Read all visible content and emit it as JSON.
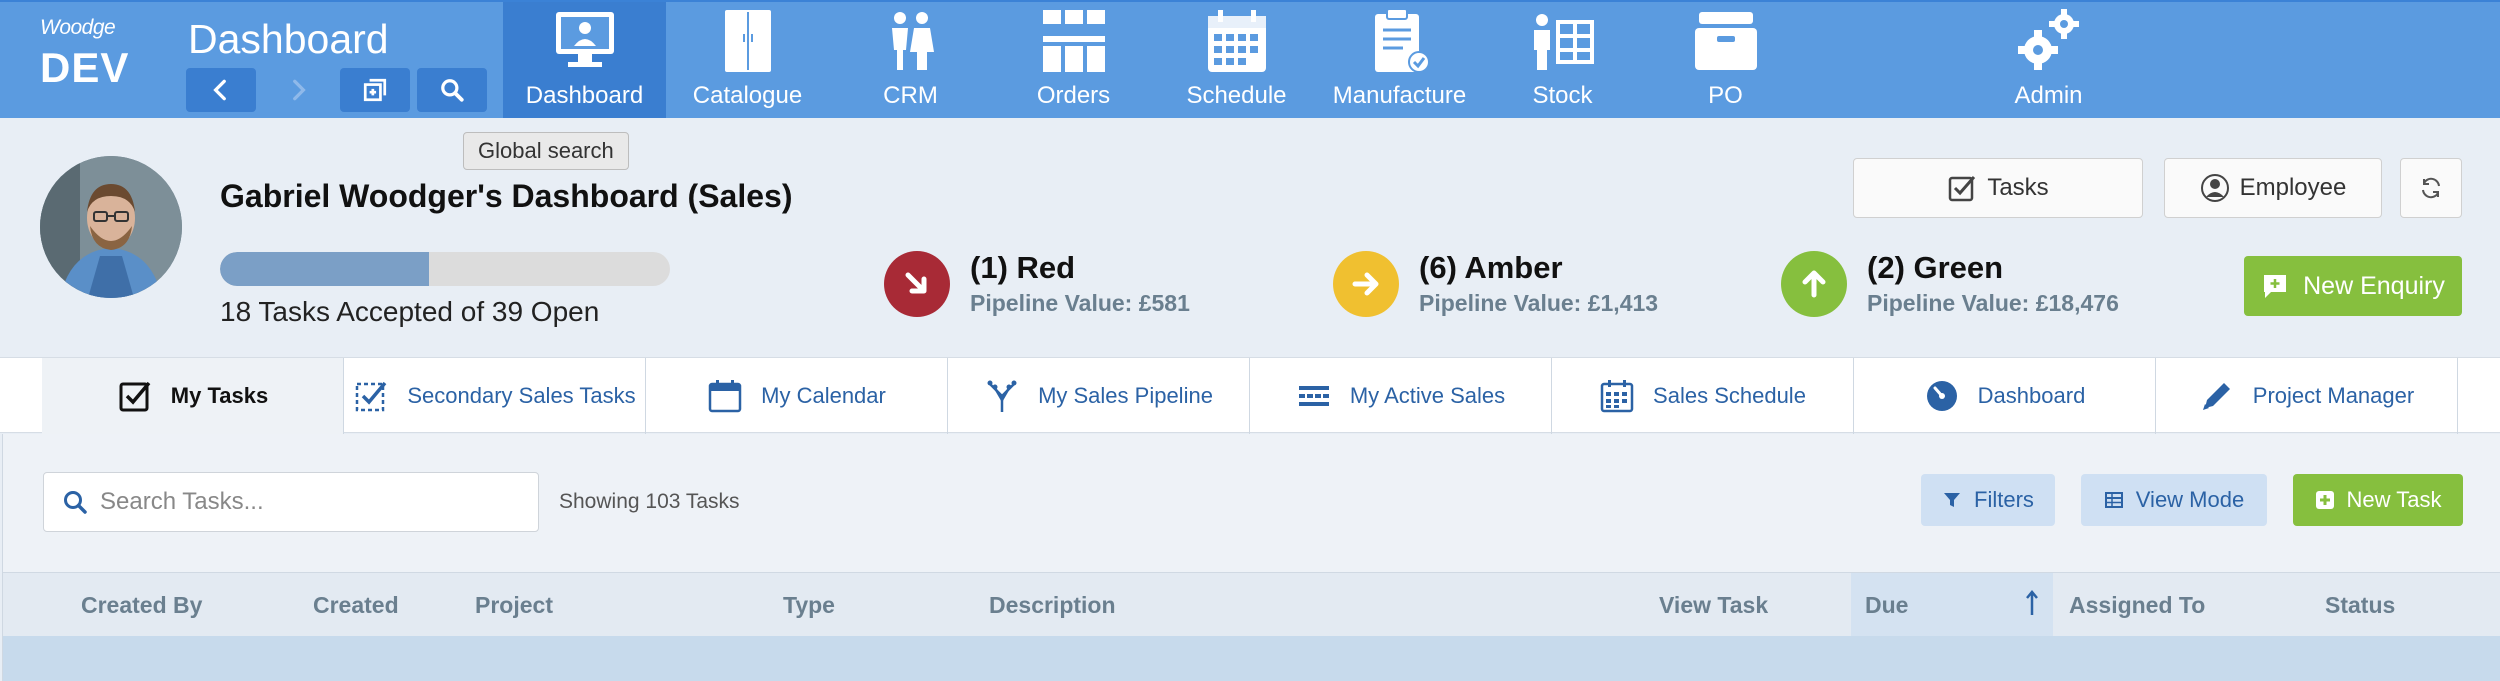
{
  "app": {
    "brand": "Woodge",
    "env": "DEV",
    "page_title": "Dashboard"
  },
  "nav_buttons": [
    "back-icon",
    "forward-icon",
    "new-window-icon",
    "search-icon"
  ],
  "modules": [
    {
      "label": "Dashboard",
      "icon": "monitor-icon",
      "active": true
    },
    {
      "label": "Catalogue",
      "icon": "wardrobe-icon",
      "active": false
    },
    {
      "label": "CRM",
      "icon": "people-icon",
      "active": false
    },
    {
      "label": "Orders",
      "icon": "kitchen-icon",
      "active": false
    },
    {
      "label": "Schedule",
      "icon": "calendar-icon",
      "active": false
    },
    {
      "label": "Manufacture",
      "icon": "clipboard-icon",
      "active": false
    },
    {
      "label": "Stock",
      "icon": "stock-icon",
      "active": false
    },
    {
      "label": "PO",
      "icon": "tray-icon",
      "active": false
    },
    {
      "label": "Admin",
      "icon": "gears-icon",
      "active": false
    }
  ],
  "tooltip": "Global search",
  "dashboard": {
    "title": "Gabriel Woodger's Dashboard (Sales)",
    "progress_fraction": 0.465,
    "progress_text": "18 Tasks Accepted of 39 Open"
  },
  "rag": [
    {
      "title": "(1) Red",
      "pipeline": "Pipeline Value: £581",
      "color": "#a82a36"
    },
    {
      "title": "(6) Amber",
      "pipeline": "Pipeline Value: £1,413",
      "color": "#f0c030"
    },
    {
      "title": "(2) Green",
      "pipeline": "Pipeline Value: £18,476",
      "color": "#86bf3e"
    }
  ],
  "header_buttons": {
    "tasks": "Tasks",
    "employee": "Employee",
    "new_enquiry": "New Enquiry"
  },
  "subtabs": [
    {
      "label": "My Tasks",
      "icon": "checkbox-icon",
      "active": true
    },
    {
      "label": "Secondary Sales Tasks",
      "icon": "checklist-icon",
      "active": false
    },
    {
      "label": "My Calendar",
      "icon": "calendar-icon",
      "active": false
    },
    {
      "label": "My Sales Pipeline",
      "icon": "pipeline-icon",
      "active": false
    },
    {
      "label": "My Active Sales",
      "icon": "active-sales-icon",
      "active": false
    },
    {
      "label": "Sales Schedule",
      "icon": "schedule-icon",
      "active": false
    },
    {
      "label": "Dashboard",
      "icon": "gauge-icon",
      "active": false
    },
    {
      "label": "Project Manager",
      "icon": "pencil-icon",
      "active": false
    }
  ],
  "tasks": {
    "search_placeholder": "Search Tasks...",
    "showing": "Showing 103 Tasks",
    "filters": "Filters",
    "view_mode": "View Mode",
    "new_task": "New Task"
  },
  "columns": [
    "Created By",
    "Created",
    "Project",
    "Type",
    "Description",
    "View Task",
    "Due",
    "Assigned To",
    "Status"
  ],
  "sorted_column": "Due"
}
